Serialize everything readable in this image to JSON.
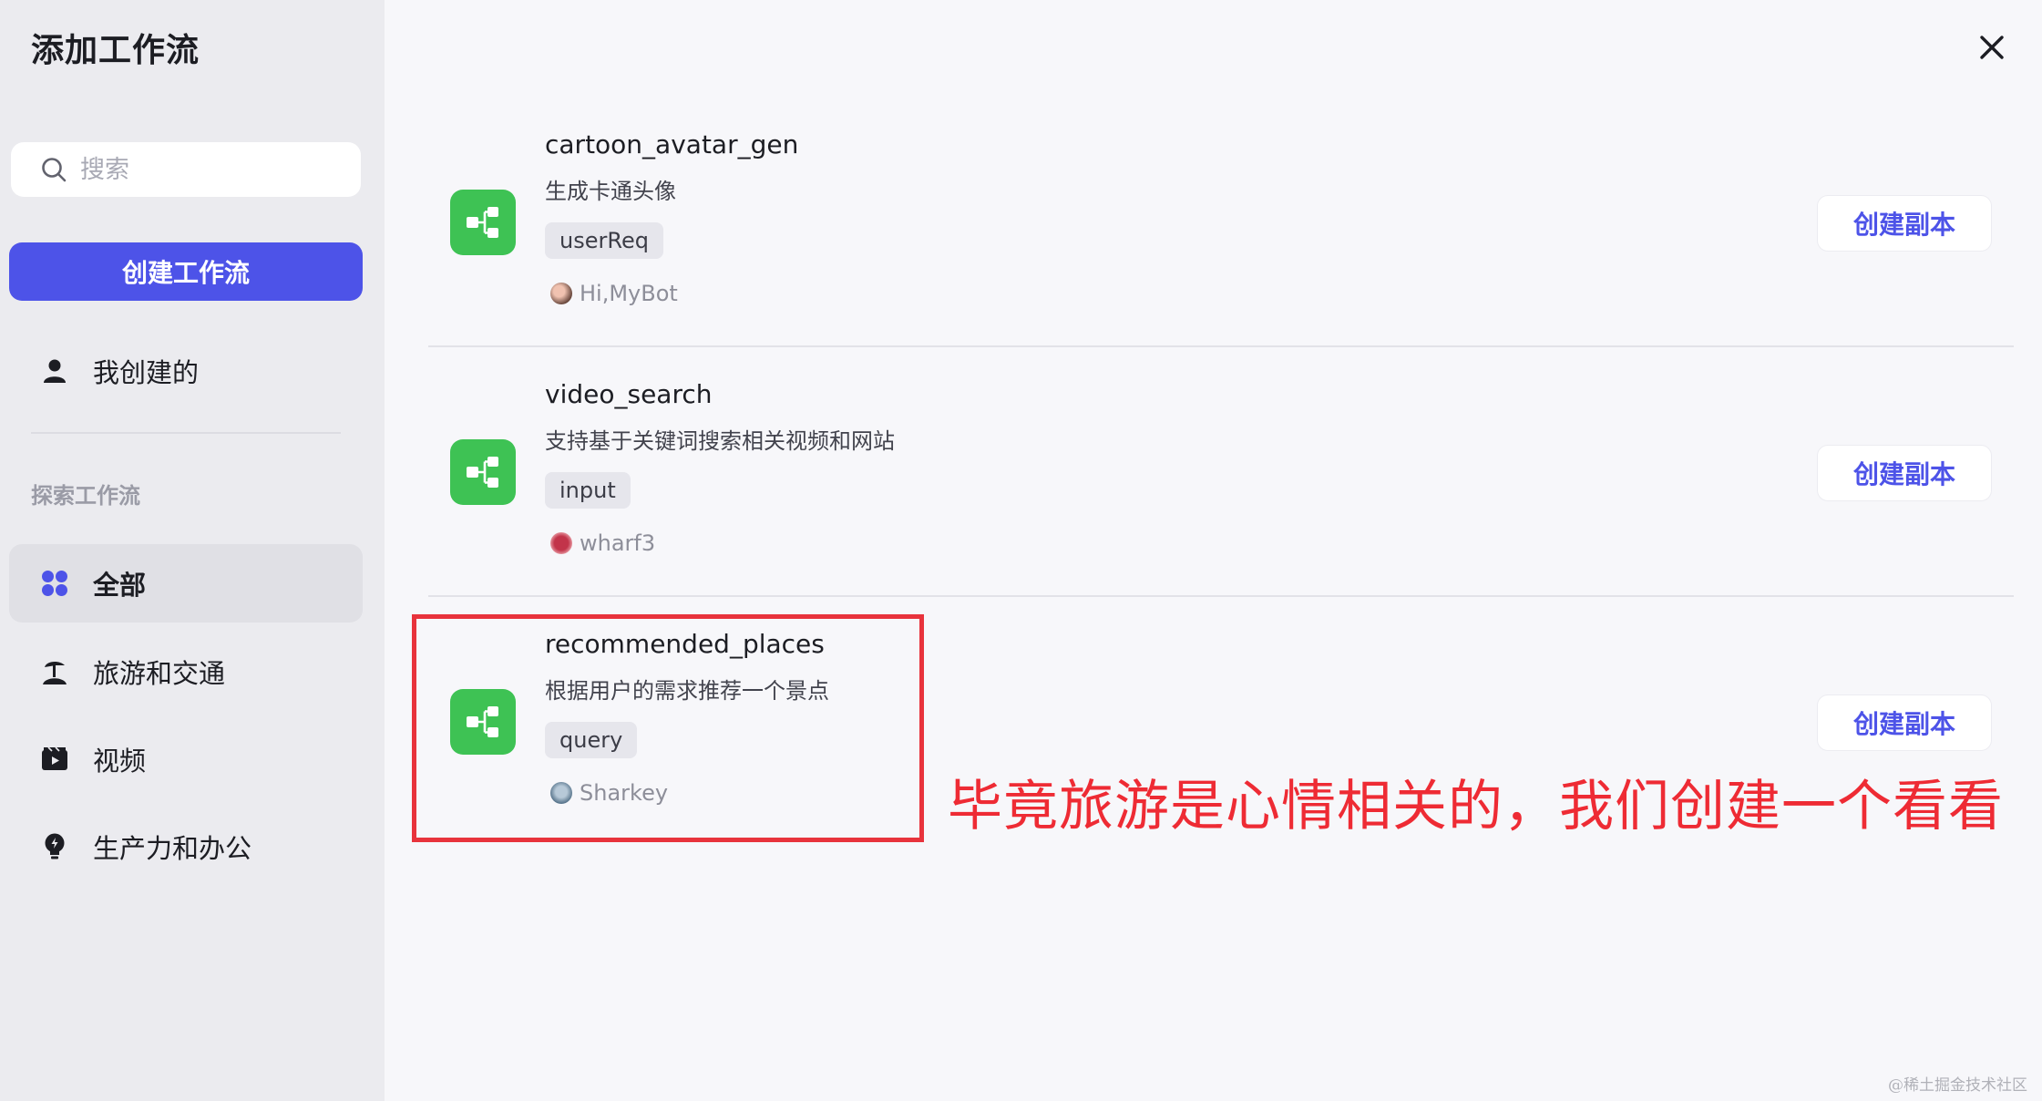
{
  "sidebar": {
    "title": "添加工作流",
    "search_placeholder": "搜索",
    "create_button": "创建工作流",
    "my_created": "我创建的",
    "explore_label": "探索工作流",
    "categories": [
      {
        "label": "全部",
        "icon": "grid-icon"
      },
      {
        "label": "旅游和交通",
        "icon": "beach-icon"
      },
      {
        "label": "视频",
        "icon": "video-icon"
      },
      {
        "label": "生产力和办公",
        "icon": "lightbulb-icon"
      }
    ]
  },
  "workflows": [
    {
      "name": "cartoon_avatar_gen",
      "description": "生成卡通头像",
      "tag": "userReq",
      "author": "Hi,MyBot",
      "action": "创建副本"
    },
    {
      "name": "video_search",
      "description": "支持基于关键词搜索相关视频和网站",
      "tag": "input",
      "author": "wharf3",
      "action": "创建副本"
    },
    {
      "name": "recommended_places",
      "description": "根据用户的需求推荐一个景点",
      "tag": "query",
      "author": "Sharkey",
      "action": "创建副本"
    }
  ],
  "annotation": "毕竟旅游是心情相关的，我们创建一个看看",
  "watermark": "@稀土掘金技术社区",
  "colors": {
    "accent": "#4d53e8",
    "workflow_icon": "#3ec254",
    "annotation": "#ee2b34",
    "sidebar_bg": "#ebebef"
  }
}
